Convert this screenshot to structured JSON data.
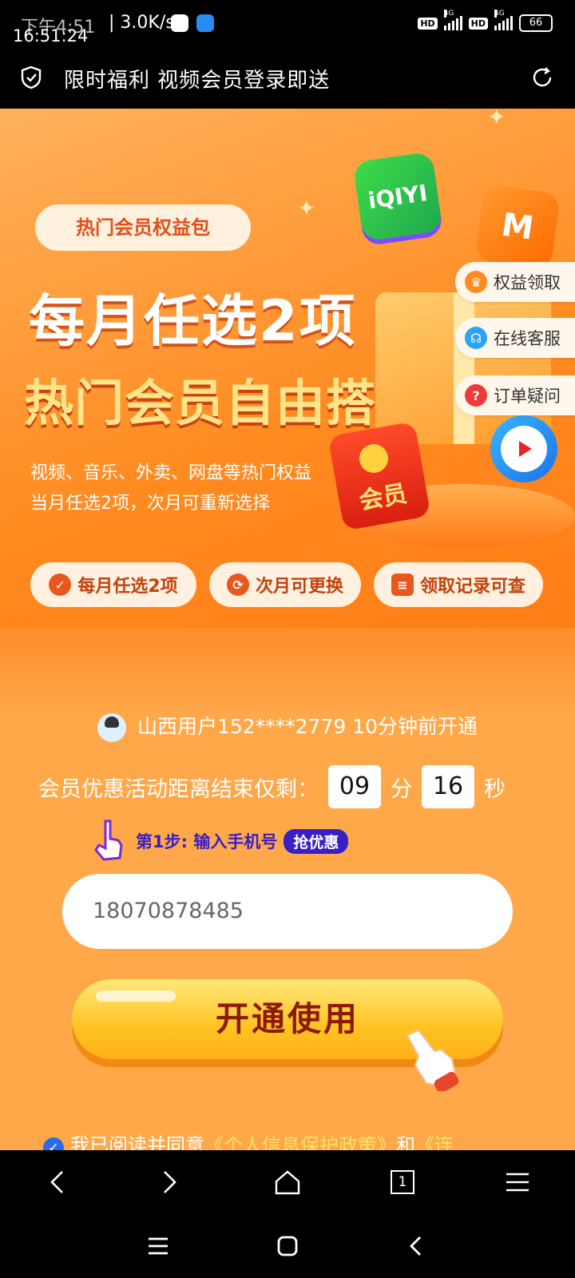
{
  "status_bar": {
    "time_overlay": "下午4:51",
    "time": "16:51:24",
    "speed": "| 3.0K/s",
    "network_1": "4G",
    "network_2": "4G",
    "hd_label": "HD",
    "battery": "66"
  },
  "browser_title": "限时福利 视频会员登录即送",
  "banner": {
    "tag": "热门会员权益包",
    "headline_1": "每月任选2项",
    "headline_2": "热门会员自由搭配",
    "desc_1": "视频、音乐、外卖、网盘等热门权益",
    "desc_2": "当月任选2项，次月可重新选择",
    "features": [
      "每月任选2项",
      "次月可更换",
      "领取记录可查"
    ],
    "redpacket_label": "会员",
    "iqiyi_logo": "iQIYI",
    "mgtv_logo": "M"
  },
  "side_buttons": [
    {
      "label": "权益领取",
      "icon": "crown-icon"
    },
    {
      "label": "在线客服",
      "icon": "headset-icon"
    },
    {
      "label": "订单疑问",
      "icon": "question-icon"
    }
  ],
  "user_notice": "山西用户152****2779 10分钟前开通",
  "countdown": {
    "label": "会员优惠活动距离结束仅剩：",
    "minutes": "09",
    "minutes_unit": "分",
    "seconds": "16",
    "seconds_unit": "秒"
  },
  "step": {
    "text": "第1步: 输入手机号",
    "badge": "抢优惠"
  },
  "phone_input": {
    "value": "18070878485"
  },
  "cta_label": "开通使用",
  "agreement": {
    "prefix": "我已阅读并同意",
    "link_1": "《个人信息保护政策》",
    "middle": "和",
    "link_2": "《连"
  },
  "browser_tabs_count": "1",
  "colors": {
    "banner_orange": "#ff8a1f",
    "page_bg": "#ffa84a",
    "cta_yellow": "#ffc323",
    "step_purple": "#3a1fc4"
  }
}
